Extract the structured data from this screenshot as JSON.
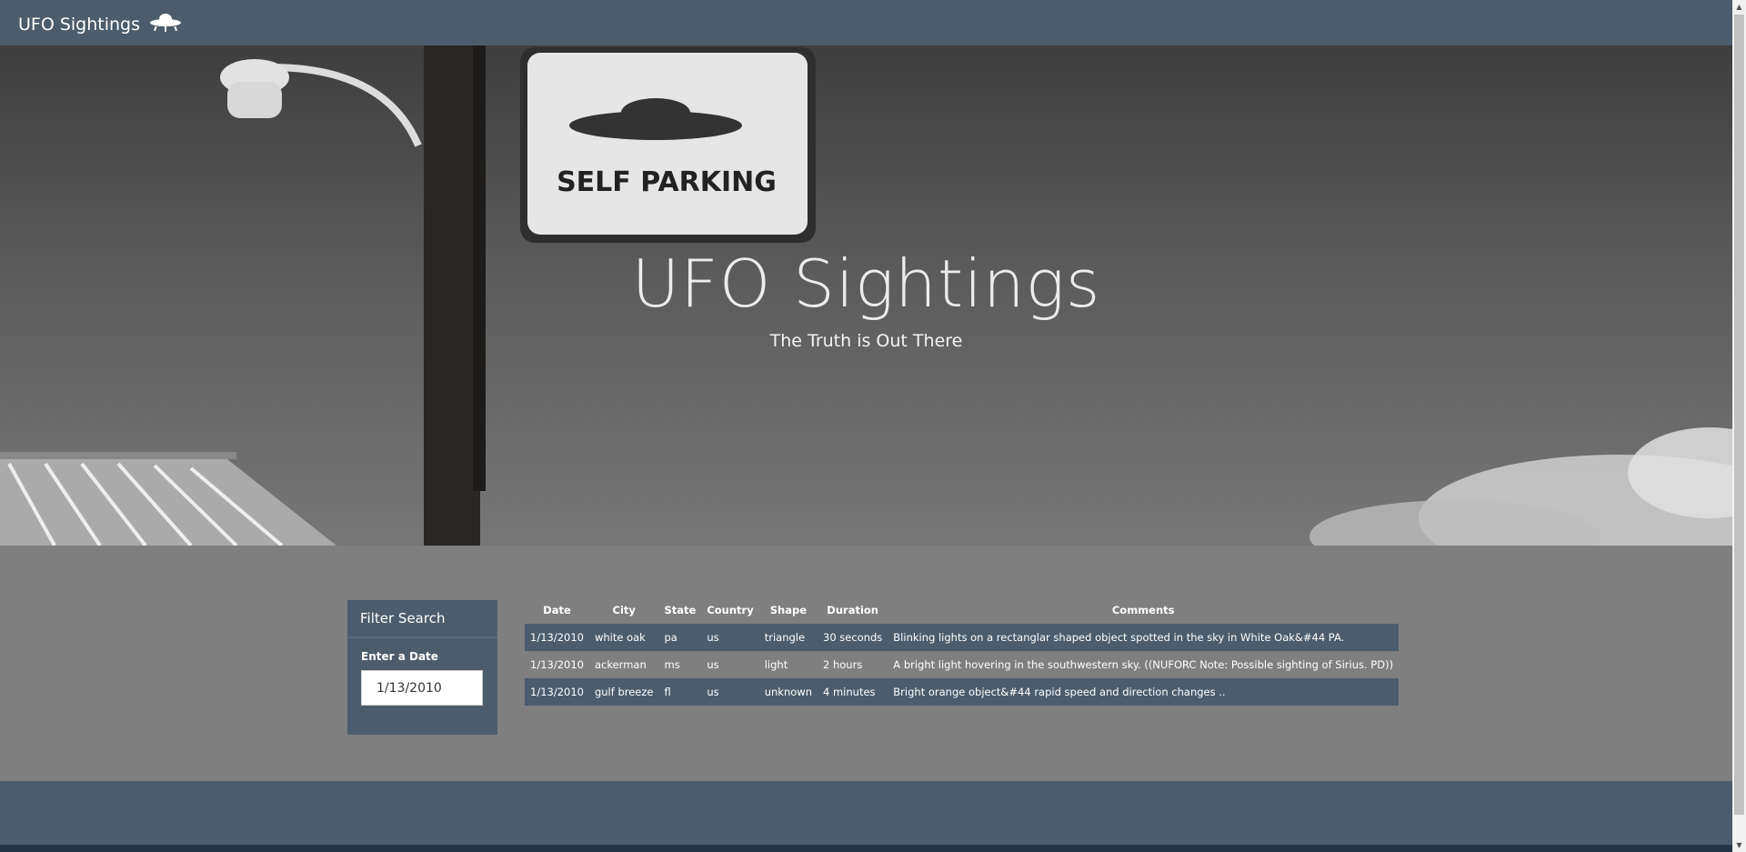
{
  "navbar": {
    "brand": "UFO Sightings",
    "brand_icon": "ufo-icon"
  },
  "hero": {
    "title": "UFO Sightings",
    "subtitle": "The Truth is Out There",
    "sign_text": "SELF PARKING"
  },
  "filter": {
    "heading": "Filter Search",
    "label": "Enter a Date",
    "value": "1/13/2010"
  },
  "table": {
    "headers": [
      "Date",
      "City",
      "State",
      "Country",
      "Shape",
      "Duration",
      "Comments"
    ],
    "rows": [
      [
        "1/13/2010",
        "white oak",
        "pa",
        "us",
        "triangle",
        "30 seconds",
        "Blinking lights on a rectanglar shaped object spotted in the sky in White Oak&#44 PA."
      ],
      [
        "1/13/2010",
        "ackerman",
        "ms",
        "us",
        "light",
        "2 hours",
        "A bright light hovering in the southwestern sky. ((NUFORC Note: Possible sighting of Sirius. PD))"
      ],
      [
        "1/13/2010",
        "gulf breeze",
        "fl",
        "us",
        "unknown",
        "4 minutes",
        "Bright orange object&#44 rapid speed and direction changes .."
      ]
    ]
  },
  "colors": {
    "navbar": "#4b5c6c",
    "background": "#7f7f7f",
    "row_dark": "#4b5c6c"
  }
}
